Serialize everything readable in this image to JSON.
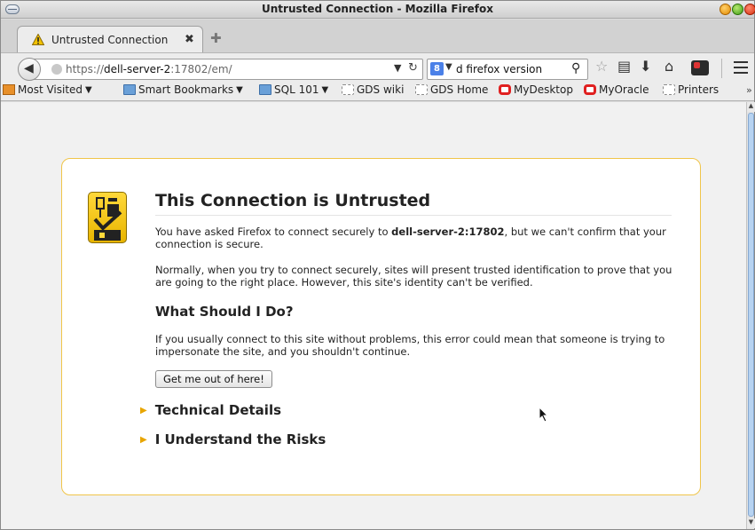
{
  "window": {
    "title": "Untrusted Connection - Mozilla Firefox"
  },
  "tab": {
    "label": "Untrusted Connection",
    "close_glyph": "✖",
    "new_tab_glyph": "✚"
  },
  "navbar": {
    "url_scheme": "https://",
    "url_host": "dell-server-2",
    "url_rest": ":17802/em/",
    "search_engine_glyph": "8",
    "search_text": "d firefox version",
    "icons": [
      "star-icon",
      "reading-list-icon",
      "download-icon",
      "home-icon",
      "addon-icon",
      "menu-icon"
    ]
  },
  "bookmarks": {
    "items": [
      {
        "label": "Most Visited",
        "icon": "most-visited-icon",
        "dropdown": true
      },
      {
        "label": "Smart Bookmarks",
        "icon": "folder-icon",
        "dropdown": true
      },
      {
        "label": "SQL 101",
        "icon": "folder-icon",
        "dropdown": true
      },
      {
        "label": "GDS wiki",
        "icon": "page-icon",
        "dropdown": false
      },
      {
        "label": "GDS Home",
        "icon": "page-icon",
        "dropdown": false
      },
      {
        "label": "MyDesktop",
        "icon": "oracle-icon",
        "dropdown": false
      },
      {
        "label": "MyOracle",
        "icon": "oracle-icon",
        "dropdown": false
      },
      {
        "label": "Printers",
        "icon": "page-icon",
        "dropdown": false
      }
    ],
    "overflow_glyph": "»"
  },
  "error_page": {
    "title": "This Connection is Untrusted",
    "p1_before": "You have asked Firefox to connect securely to ",
    "p1_host": "dell-server-2:17802",
    "p1_after": ", but we can't confirm that your connection is secure.",
    "p2": "Normally, when you try to connect securely, sites will present trusted identification to prove that you are going to the right place. However, this site's identity can't be verified.",
    "h2": "What Should I Do?",
    "p3": "If you usually connect to this site without problems, this error could mean that someone is trying to impersonate the site, and you shouldn't continue.",
    "button": "Get me out of here!",
    "technical_details": "Technical Details",
    "understand_risks": "I Understand the Risks"
  },
  "colors": {
    "panel_border": "#f0c54a",
    "expander_triangle": "#e8a500",
    "oracle_red": "#e02020"
  }
}
